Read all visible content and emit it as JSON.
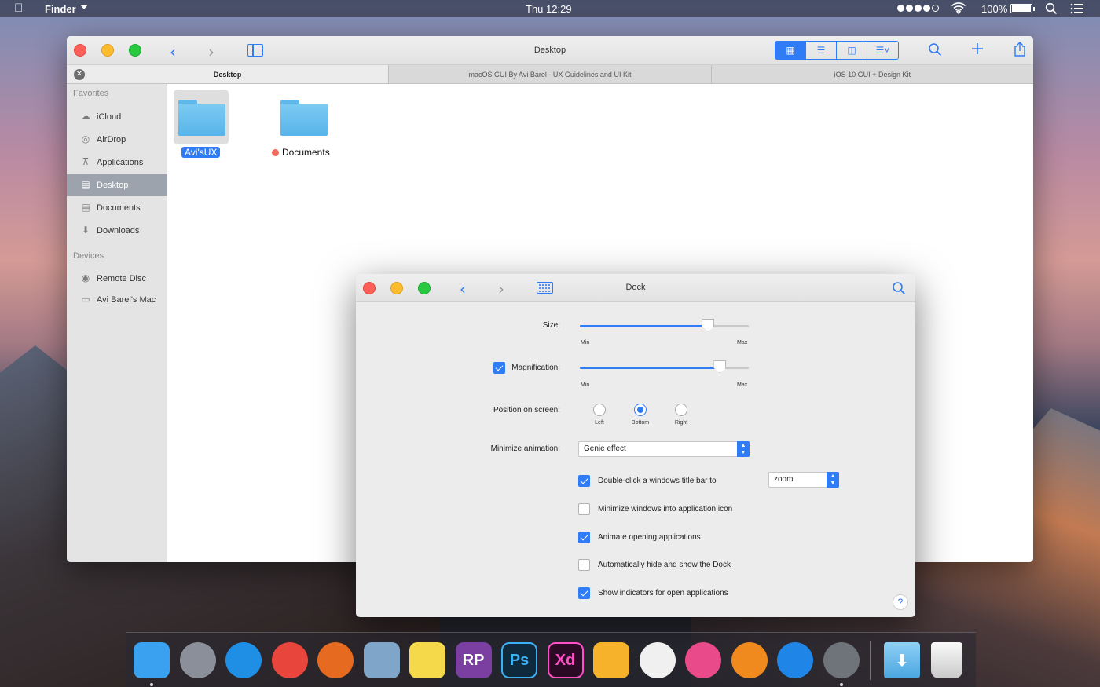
{
  "menubar": {
    "apple_icon": "apple-logo-icon",
    "app_name": "Finder",
    "clock": "Thu 12:29",
    "battery": "100%"
  },
  "finder": {
    "title": "Desktop",
    "tabs": [
      {
        "label": "Desktop",
        "active": true
      },
      {
        "label": "macOS GUI By Avi Barel - UX Guidelines and UI Kit",
        "active": false
      },
      {
        "label": "iOS 10 GUI + Design Kit",
        "active": false
      }
    ],
    "sidebar": {
      "favorites_heading": "Favorites",
      "favorites": [
        {
          "label": "iCloud",
          "icon": "cloud-icon"
        },
        {
          "label": "AirDrop",
          "icon": "airdrop-icon"
        },
        {
          "label": "Applications",
          "icon": "applications-icon"
        },
        {
          "label": "Desktop",
          "icon": "desktop-icon",
          "selected": true
        },
        {
          "label": "Documents",
          "icon": "documents-icon"
        },
        {
          "label": "Downloads",
          "icon": "downloads-icon"
        }
      ],
      "devices_heading": "Devices",
      "devices": [
        {
          "label": "Remote Disc",
          "icon": "disc-icon"
        },
        {
          "label": "Avi Barel's Mac",
          "icon": "laptop-icon"
        }
      ]
    },
    "files": [
      {
        "name": "Avi'sUX",
        "selected": true
      },
      {
        "name": "Documents",
        "tag": "red"
      }
    ]
  },
  "dock_prefs": {
    "title": "Dock",
    "size_label": "Size:",
    "size_value": 0.76,
    "magnification_label": "Magnification:",
    "magnification_checked": true,
    "magnification_value": 0.83,
    "min_label": "Min",
    "max_label": "Max",
    "position_label": "Position on screen:",
    "positions": [
      "Left",
      "Bottom",
      "Right"
    ],
    "position_selected": "Bottom",
    "minimize_label": "Minimize animation:",
    "minimize_value": "Genie effect",
    "options": [
      {
        "label": "Double-click a windows title bar to",
        "checked": true
      },
      {
        "label": "Minimize windows into application icon",
        "checked": false
      },
      {
        "label": "Animate opening applications",
        "checked": true
      },
      {
        "label": "Automatically hide and show the Dock",
        "checked": false
      },
      {
        "label": "Show indicators for open applications",
        "checked": true
      }
    ],
    "double_click_value": "zoom",
    "help": "?"
  },
  "dock": {
    "apps": [
      {
        "name": "finder-icon",
        "text": "",
        "color": "#3aa0f0",
        "running": true
      },
      {
        "name": "launchpad-icon",
        "text": "",
        "color": "#8a8f99",
        "running": false
      },
      {
        "name": "safari-icon",
        "text": "",
        "color": "#1f8fe6",
        "running": false
      },
      {
        "name": "chrome-icon",
        "text": "",
        "color": "#e8453c",
        "running": false
      },
      {
        "name": "firefox-icon",
        "text": "",
        "color": "#e66a1f",
        "running": false
      },
      {
        "name": "mail-icon",
        "text": "",
        "color": "#7fa6c8",
        "running": false
      },
      {
        "name": "notes-icon",
        "text": "",
        "color": "#f6d94a",
        "running": false
      },
      {
        "name": "axure-rp-icon",
        "text": "RP",
        "color": "#7a3fa0",
        "running": false
      },
      {
        "name": "photoshop-icon",
        "text": "Ps",
        "color": "#0f2a3d",
        "running": false
      },
      {
        "name": "adobe-xd-icon",
        "text": "Xd",
        "color": "#2b0a26",
        "running": false
      },
      {
        "name": "sketch-icon",
        "text": "",
        "color": "#f5b22a",
        "running": false
      },
      {
        "name": "photos-icon",
        "text": "",
        "color": "#f0f0f0",
        "running": false
      },
      {
        "name": "itunes-icon",
        "text": "",
        "color": "#e94a8a",
        "running": false
      },
      {
        "name": "ibooks-icon",
        "text": "",
        "color": "#f08a1e",
        "running": false
      },
      {
        "name": "app-store-icon",
        "text": "",
        "color": "#1f86e8",
        "running": false
      },
      {
        "name": "system-preferences-icon",
        "text": "",
        "color": "#6f737a",
        "running": true
      }
    ],
    "downloads_icon": "downloads-folder-icon",
    "trash_icon": "trash-icon"
  }
}
